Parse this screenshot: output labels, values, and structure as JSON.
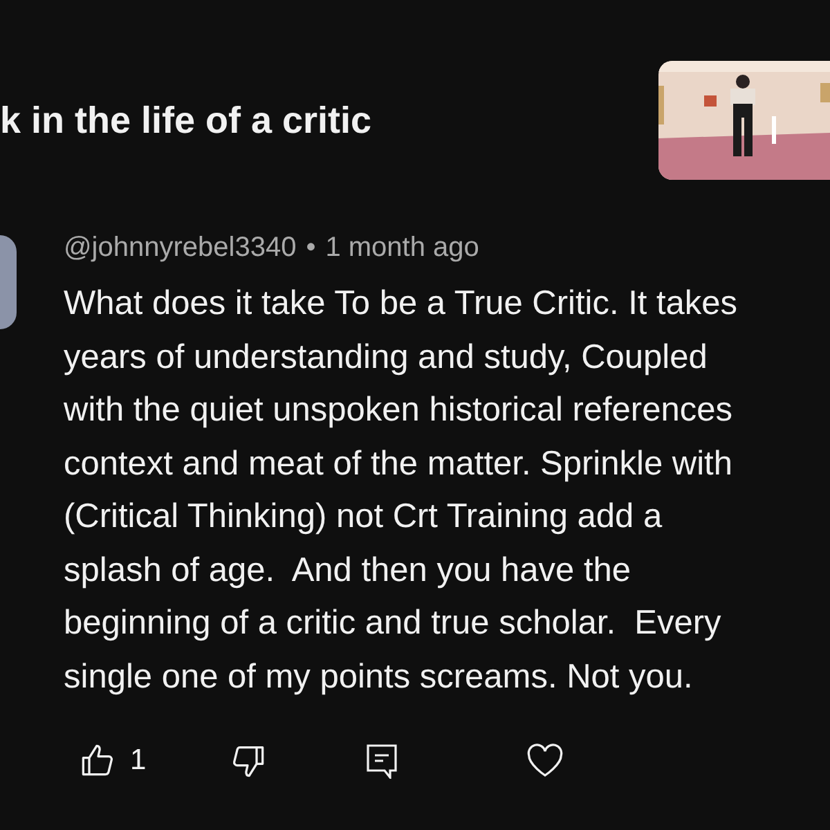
{
  "header": {
    "title": "k in the life of a critic"
  },
  "comment": {
    "author": "@johnnyrebel3340",
    "separator": "•",
    "time": "1 month ago",
    "lines": [
      "What does it take To be a True Critic. It takes",
      "years of understanding and study, Coupled",
      "with the quiet unspoken historical references",
      "context and meat of the matter. Sprinkle with",
      "(Critical Thinking) not Crt Training add a",
      "splash of age.  And then you have the",
      "beginning of a critic and true scholar.  Every",
      "single one of my points screams. Not you."
    ],
    "likes": "1"
  }
}
